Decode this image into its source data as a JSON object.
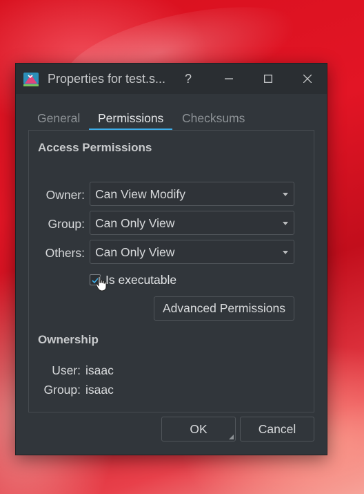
{
  "window": {
    "title": "Properties for test.s...",
    "help_glyph": "?",
    "minimize_glyph": "—",
    "maximize_glyph": "□",
    "close_glyph": "✕"
  },
  "tabs": [
    {
      "label": "General",
      "active": false
    },
    {
      "label": "Permissions",
      "active": true
    },
    {
      "label": "Checksums",
      "active": false
    }
  ],
  "access": {
    "title": "Access Permissions",
    "owner_label": "Owner:",
    "owner_value": "Can View  Modify",
    "group_label": "Group:",
    "group_value": "Can Only View",
    "others_label": "Others:",
    "others_value": "Can Only View",
    "executable_label": "Is executable",
    "advanced_button": "Advanced Permissions"
  },
  "ownership": {
    "title": "Ownership",
    "user_label": "User:",
    "user_value": "isaac",
    "group_label": "Group:",
    "group_value": "isaac"
  },
  "buttons": {
    "ok": "OK",
    "cancel": "Cancel"
  },
  "colors": {
    "accent": "#3daee9",
    "window_bg": "#31363b"
  }
}
